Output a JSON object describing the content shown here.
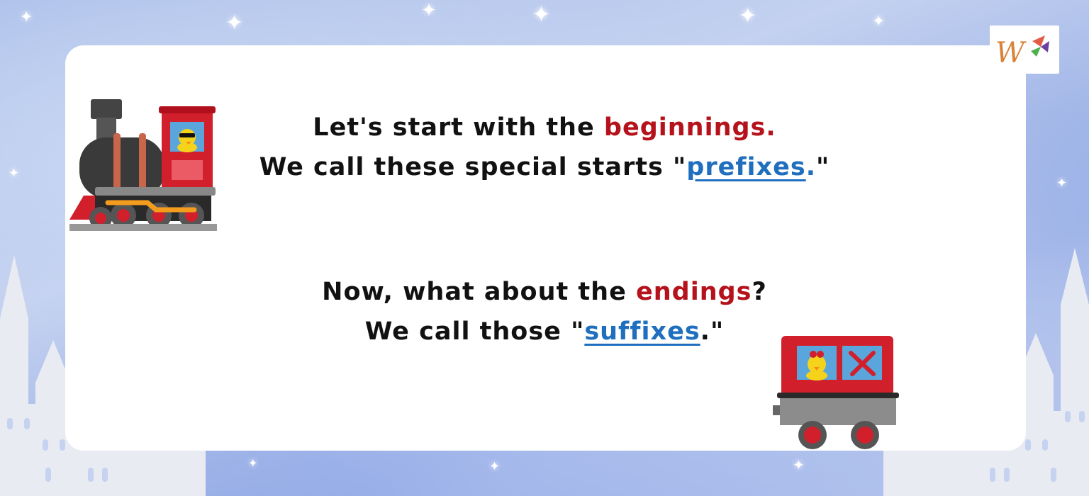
{
  "logo": {
    "icon": "w-logo-icon",
    "accent": "#d9833a"
  },
  "lines": {
    "l1": {
      "a": "Let's start with the ",
      "b": "beginnings."
    },
    "l2": {
      "a": "We call these special starts \"",
      "b": "prefixes",
      "c": ".",
      "d": "\""
    },
    "l3": {
      "a": "Now, what about the ",
      "b": "endings",
      "c": "?"
    },
    "l4": {
      "a": "We call those \"",
      "b": "suffixes",
      "c": ".\""
    }
  },
  "colors": {
    "highlight_red": "#b5121b",
    "link_blue": "#1f6fbe",
    "text": "#111111"
  },
  "icons": [
    "locomotive-icon",
    "train-car-icon",
    "duck-with-sunglasses-icon",
    "duck-with-bow-icon",
    "x-mark-icon",
    "castle-silhouette-icon",
    "sparkle-star-icon"
  ]
}
